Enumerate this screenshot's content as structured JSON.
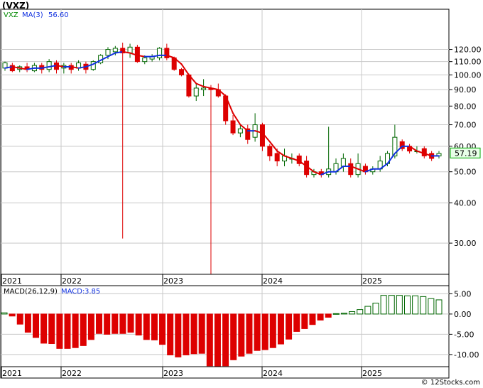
{
  "title": "(VXZ)",
  "credit": "© 12Stocks.com",
  "colors": {
    "up": "#006600",
    "down": "#dd0000",
    "ma": "#1030e0",
    "price_label_bg": "#e8ffe8",
    "grid": "#c8c8c8"
  },
  "chart_data": [
    {
      "type": "candlestick",
      "log_scale": true,
      "ylim": [
        24,
        160
      ],
      "y_ticks": [
        "120.00",
        "110.00",
        "100.00",
        "90.00",
        "80.00",
        "70.00",
        "60.00",
        "50.00",
        "40.00",
        "30.00"
      ],
      "x_ticks": [
        "2021",
        "2022",
        "2023",
        "2024",
        "2025"
      ],
      "legend_ticker": "VXZ",
      "legend_ma": "MA(3)",
      "legend_ma_value": "56.60",
      "last_price": "57.19",
      "candles": [
        [
          105,
          109,
          103,
          110
        ],
        [
          107,
          103,
          102,
          109
        ],
        [
          104,
          106,
          102,
          107
        ],
        [
          106,
          104,
          102,
          109
        ],
        [
          103,
          107,
          102,
          109
        ],
        [
          107,
          104,
          101,
          109
        ],
        [
          104,
          110,
          102,
          112
        ],
        [
          109,
          104,
          101,
          111
        ],
        [
          105,
          107,
          101,
          109
        ],
        [
          107,
          104,
          101,
          109
        ],
        [
          105,
          109,
          103,
          111
        ],
        [
          108,
          104,
          101,
          110
        ],
        [
          104,
          110,
          103,
          111
        ],
        [
          109,
          115,
          108,
          116
        ],
        [
          115,
          120,
          112,
          122
        ],
        [
          118,
          121,
          115,
          123
        ],
        [
          121,
          117,
          31,
          126
        ],
        [
          117,
          122,
          113,
          125
        ],
        [
          122,
          110,
          109,
          124
        ],
        [
          110,
          113,
          108,
          115
        ],
        [
          112,
          114,
          110,
          116
        ],
        [
          113,
          121,
          111,
          122
        ],
        [
          121,
          113,
          111,
          125
        ],
        [
          113,
          104,
          103,
          114
        ],
        [
          104,
          100,
          99,
          105
        ],
        [
          100,
          86,
          85,
          101
        ],
        [
          86,
          91,
          83,
          94
        ],
        [
          90,
          91,
          86,
          97
        ],
        [
          91,
          90,
          24,
          93
        ],
        [
          90,
          86,
          85,
          94
        ],
        [
          86,
          72,
          70,
          87
        ],
        [
          72,
          66,
          65,
          75
        ],
        [
          66,
          68,
          64,
          70
        ],
        [
          68,
          63,
          61,
          70
        ],
        [
          64,
          70,
          62,
          76
        ],
        [
          70,
          60,
          58,
          71
        ],
        [
          60,
          56,
          54,
          61
        ],
        [
          57,
          54,
          52,
          59
        ],
        [
          54,
          56,
          52,
          59
        ],
        [
          55,
          55,
          53,
          57
        ],
        [
          56,
          53,
          52,
          57
        ],
        [
          54,
          49,
          48,
          56
        ],
        [
          49,
          50,
          48,
          51
        ],
        [
          50,
          49,
          48,
          51
        ],
        [
          49,
          51,
          48,
          69
        ],
        [
          50,
          53,
          49,
          55
        ],
        [
          52,
          55,
          50,
          57
        ],
        [
          53,
          49,
          48,
          55
        ],
        [
          49,
          53,
          48,
          57
        ],
        [
          52,
          50,
          49,
          53
        ],
        [
          50,
          51,
          49,
          52
        ],
        [
          51,
          54,
          50,
          56
        ],
        [
          53,
          57,
          52,
          58
        ],
        [
          56,
          64,
          55,
          70
        ],
        [
          62,
          59,
          58,
          63
        ],
        [
          60,
          58,
          57,
          61
        ],
        [
          58,
          58,
          57,
          60
        ],
        [
          59,
          56,
          55,
          60
        ],
        [
          57,
          55,
          54,
          58
        ],
        [
          56,
          57,
          55,
          58
        ]
      ],
      "ma3": [
        105,
        106,
        105,
        104,
        105,
        105,
        106,
        107,
        106,
        106,
        105,
        106,
        108,
        111,
        114,
        117,
        118,
        117,
        115,
        114,
        114,
        115,
        115,
        113,
        108,
        100,
        94,
        92,
        91,
        90,
        86,
        76,
        70,
        67,
        67,
        66,
        62,
        58,
        56,
        55,
        54,
        52,
        50,
        49,
        50,
        50,
        52,
        52,
        51,
        50,
        51,
        51,
        53,
        57,
        60,
        60,
        58,
        57,
        56,
        56
      ]
    },
    {
      "type": "bar",
      "title": "MACD(26,12,9)",
      "legend_macd": "MACD:",
      "legend_macd_value": "3.85",
      "ylim": [
        -13,
        7
      ],
      "y_ticks": [
        "5.00",
        "0.00",
        "-5.00",
        "-10.00"
      ],
      "x_ticks": [
        "2021",
        "2022",
        "2023",
        "2024",
        "2025"
      ],
      "values": [
        0.3,
        -0.5,
        -2.5,
        -4.5,
        -5.8,
        -7.2,
        -7.3,
        -8.5,
        -8.5,
        -8.3,
        -7.8,
        -6.3,
        -4.8,
        -5.0,
        -4.8,
        -4.8,
        -4.5,
        -5.2,
        -6.3,
        -6.4,
        -7.5,
        -10.1,
        -10.6,
        -10.1,
        -9.8,
        -9.7,
        -12.8,
        -13.6,
        -12.8,
        -11.3,
        -10.4,
        -9.7,
        -9.0,
        -8.8,
        -8.3,
        -7.4,
        -6.2,
        -4.3,
        -3.6,
        -2.6,
        -1.5,
        -0.8,
        0.1,
        0.2,
        0.6,
        1.1,
        1.9,
        2.7,
        4.6,
        4.6,
        4.6,
        4.5,
        4.5,
        4.3,
        3.8,
        3.5
      ]
    }
  ]
}
